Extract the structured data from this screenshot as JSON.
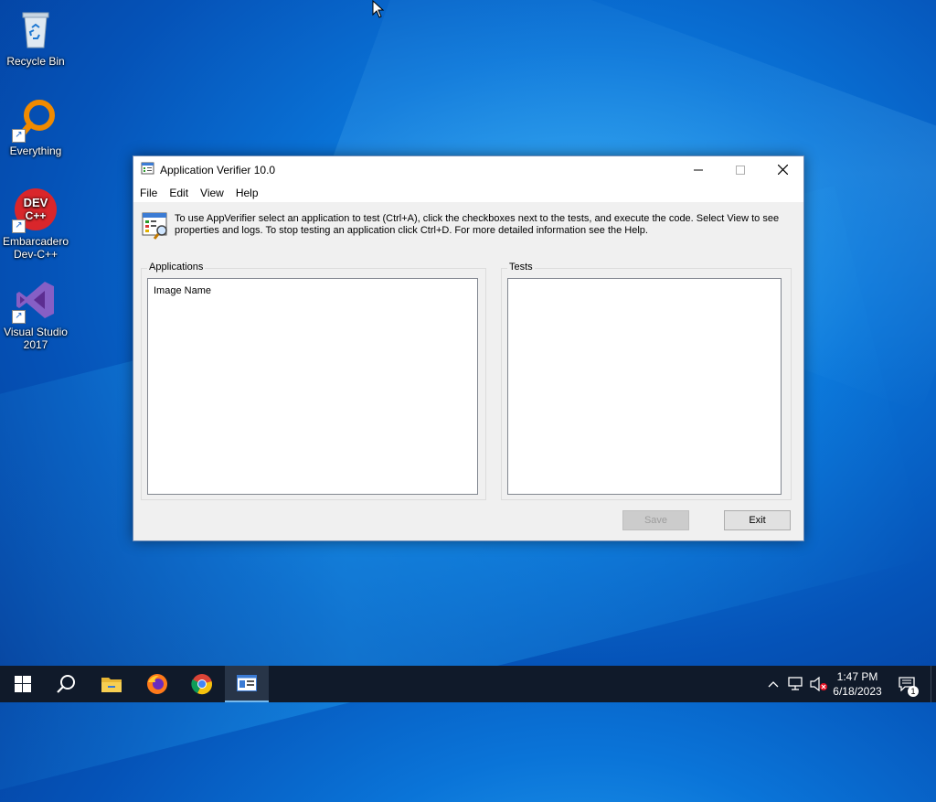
{
  "desktop": {
    "icons": [
      {
        "label": "Recycle Bin"
      },
      {
        "label": "Everything"
      },
      {
        "label": "Embarcadero Dev-C++",
        "label_line1": "Embarcadero",
        "label_line2": "Dev-C++",
        "logo_text_1": "DEV",
        "logo_text_2": "C++"
      },
      {
        "label": "Visual Studio 2017",
        "label_line1": "Visual Studio",
        "label_line2": "2017"
      }
    ]
  },
  "window": {
    "title": "Application Verifier 10.0",
    "menu": [
      "File",
      "Edit",
      "View",
      "Help"
    ],
    "info_text": "To use AppVerifier select an application to test (Ctrl+A), click the checkboxes next to the tests, and execute the code. Select View to see properties and logs. To stop testing an application click Ctrl+D. For more detailed information see the Help.",
    "applications": {
      "label": "Applications",
      "column_header": "Image Name",
      "items": []
    },
    "tests": {
      "label": "Tests",
      "items": []
    },
    "buttons": {
      "save": "Save",
      "exit": "Exit"
    },
    "save_enabled": false
  },
  "taskbar": {
    "apps": [
      "start",
      "search",
      "file-explorer",
      "firefox",
      "chrome",
      "application-verifier"
    ],
    "active_app": "application-verifier",
    "tray": {
      "time": "1:47 PM",
      "date": "6/18/2023",
      "notification_count": "1"
    }
  },
  "colors": {
    "desktop_accent": "#0a74d8",
    "taskbar": "#101a2a",
    "close_hover": "#e81123"
  }
}
